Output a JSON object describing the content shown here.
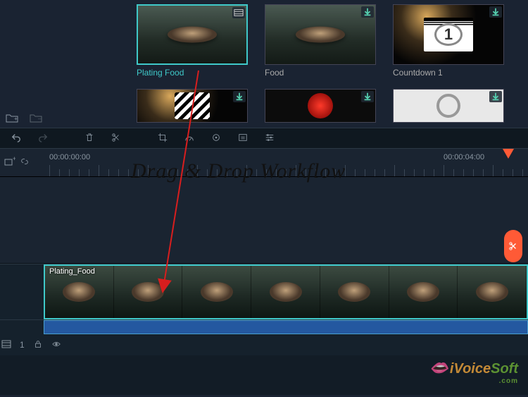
{
  "library": {
    "items": [
      {
        "label": "Plating Food",
        "selected": true,
        "has_film_badge": true,
        "has_download_badge": false
      },
      {
        "label": "Food",
        "selected": false,
        "has_film_badge": false,
        "has_download_badge": true
      },
      {
        "label": "Countdown 1",
        "selected": false,
        "has_film_badge": false,
        "has_download_badge": true
      }
    ],
    "row2_items": [
      {
        "has_download_badge": true
      },
      {
        "has_download_badge": true
      },
      {
        "has_download_badge": true
      }
    ]
  },
  "timeline": {
    "ruler_labels": [
      "00:00:00:00",
      "00:00:04:00"
    ],
    "clip_label": "Plating_Food",
    "track_index": "1",
    "frame_count": 7
  },
  "annotation": {
    "text": "Drag & Drop Workflow"
  },
  "watermark": {
    "brand_a": "iVoice",
    "brand_b": "Soft",
    "tld": ".com"
  },
  "icons": {
    "folder_add": "folder-add-icon",
    "folder_sub": "folder-sub-icon",
    "undo": "undo-icon",
    "redo": "redo-icon",
    "delete": "delete-icon",
    "split": "split-icon",
    "crop": "crop-icon",
    "speed": "speed-icon",
    "color": "color-icon",
    "green": "green-screen-icon",
    "settings": "settings-icon",
    "add_track": "add-track-icon",
    "link": "link-icon",
    "scissors": "scissors-icon",
    "lock": "lock-icon",
    "eye": "eye-icon",
    "film_badge": "film-badge-icon",
    "download_badge": "download-badge-icon"
  }
}
